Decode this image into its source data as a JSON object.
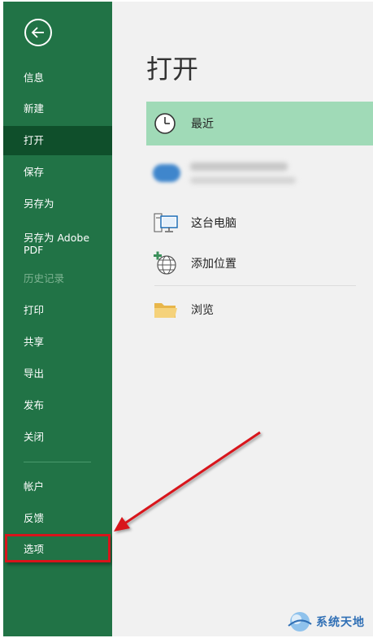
{
  "sidebar": {
    "items": [
      {
        "label": "信息"
      },
      {
        "label": "新建"
      },
      {
        "label": "打开"
      },
      {
        "label": "保存"
      },
      {
        "label": "另存为"
      },
      {
        "label": "另存为 Adobe\nPDF"
      },
      {
        "label": "历史记录"
      },
      {
        "label": "打印"
      },
      {
        "label": "共享"
      },
      {
        "label": "导出"
      },
      {
        "label": "发布"
      },
      {
        "label": "关闭"
      },
      {
        "label": "帐户"
      },
      {
        "label": "反馈"
      },
      {
        "label": "选项"
      }
    ],
    "active_item": "打开",
    "highlighted_item": "选项"
  },
  "main": {
    "title": "打开",
    "places": [
      {
        "label": "最近",
        "icon": "clock-icon"
      },
      {
        "label": "这台电脑",
        "icon": "computer-icon"
      },
      {
        "label": "添加位置",
        "icon": "add-location-icon"
      },
      {
        "label": "浏览",
        "icon": "folder-icon"
      }
    ]
  },
  "watermark": {
    "text": "系统天地"
  },
  "colors": {
    "sidebar_bg": "#217346",
    "sidebar_active": "#0f4f2b",
    "selected_row": "#a0dab7",
    "annotation_red": "#d8141b"
  }
}
